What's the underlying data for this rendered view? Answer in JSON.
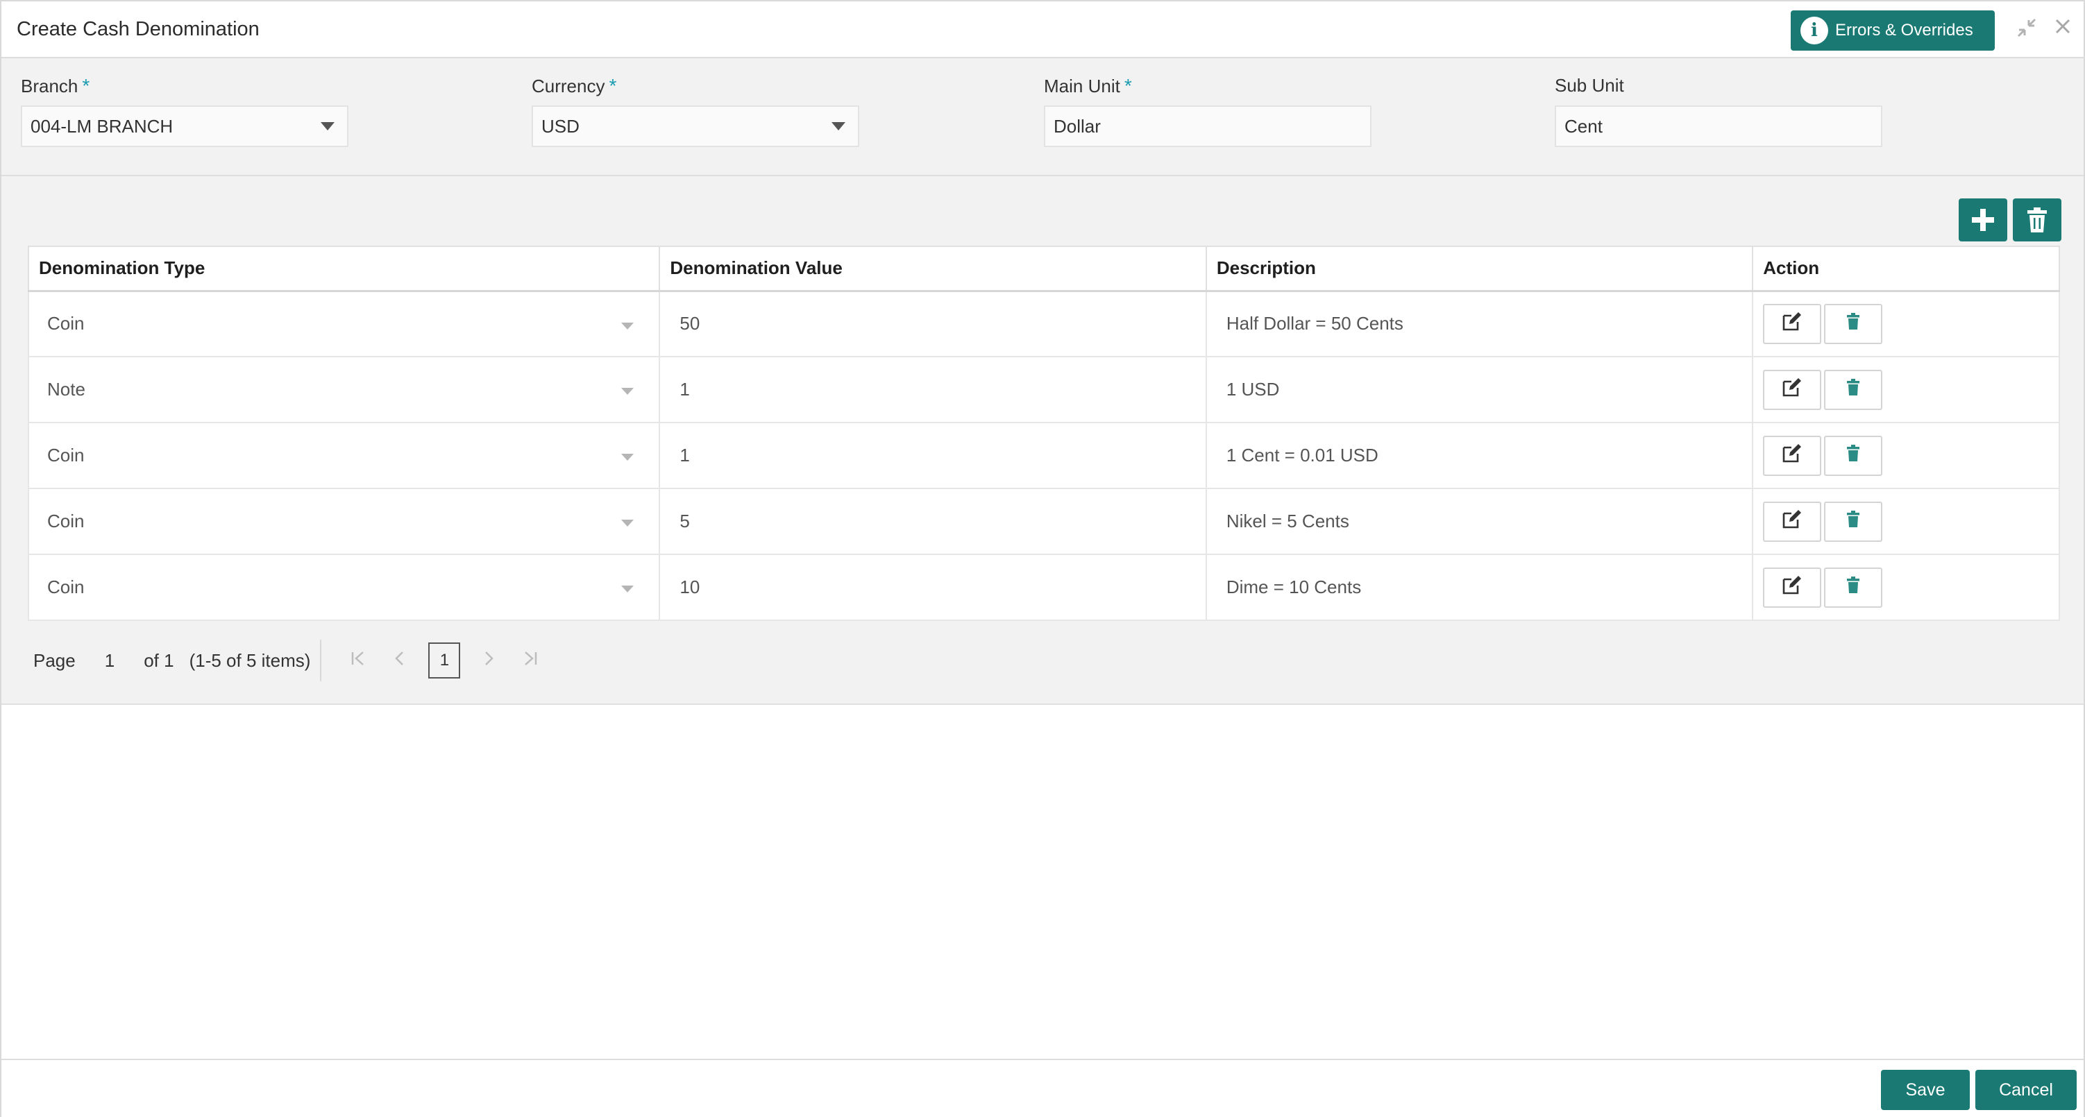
{
  "header": {
    "title": "Create Cash Denomination",
    "errors_label": "Errors & Overrides"
  },
  "form": {
    "branch": {
      "label": "Branch",
      "value": "004-LM BRANCH",
      "required": true
    },
    "currency": {
      "label": "Currency",
      "value": "USD",
      "required": true
    },
    "main_unit": {
      "label": "Main Unit",
      "value": "Dollar",
      "required": true
    },
    "sub_unit": {
      "label": "Sub Unit",
      "value": "Cent",
      "required": false
    }
  },
  "table": {
    "columns": [
      "Denomination Type",
      "Denomination Value",
      "Description",
      "Action"
    ],
    "rows": [
      {
        "type": "Coin",
        "value": "50",
        "description": "Half Dollar = 50 Cents"
      },
      {
        "type": "Note",
        "value": "1",
        "description": "1 USD"
      },
      {
        "type": "Coin",
        "value": "1",
        "description": "1 Cent = 0.01 USD"
      },
      {
        "type": "Coin",
        "value": "5",
        "description": "Nikel = 5 Cents"
      },
      {
        "type": "Coin",
        "value": "10",
        "description": "Dime = 10 Cents"
      }
    ]
  },
  "pager": {
    "page_label": "Page",
    "page_number": "1",
    "of_label": "of 1",
    "items_label": "(1-5 of 5 items)",
    "current": "1"
  },
  "footer": {
    "save_label": "Save",
    "cancel_label": "Cancel"
  },
  "colors": {
    "accent": "#1a7a73",
    "required": "#1a9cb0"
  }
}
